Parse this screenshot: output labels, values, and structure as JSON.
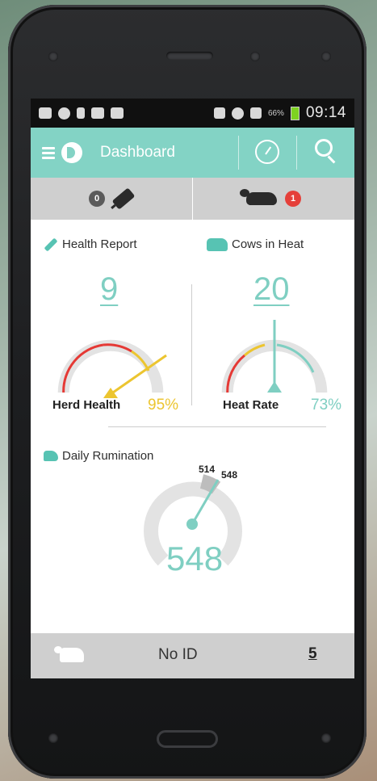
{
  "status_bar": {
    "battery_percent": "66%",
    "time": "09:14"
  },
  "app_bar": {
    "title": "Dashboard"
  },
  "tabs": [
    {
      "badge": "0",
      "icon": "plug-icon",
      "badge_color": "#5b5b5b"
    },
    {
      "badge": "1",
      "icon": "cow-lying-icon",
      "badge_color": "#e5403a"
    }
  ],
  "health_report": {
    "title": "Health Report",
    "count": "9",
    "gauge_label": "Herd Health",
    "gauge_value": "95%",
    "value_fraction": 0.95,
    "value_color": "#ecc530"
  },
  "cows_in_heat": {
    "title": "Cows in Heat",
    "count": "20",
    "gauge_label": "Heat Rate",
    "gauge_value": "73%",
    "value_fraction": 0.73,
    "value_color": "#7fcfc2"
  },
  "daily_rumination": {
    "title": "Daily Rumination",
    "value": "548",
    "reference_a": "514",
    "reference_b": "548"
  },
  "footer": {
    "id_text": "No ID",
    "count": "5"
  },
  "colors": {
    "accent": "#83d3c5",
    "teal_text": "#7fcfc2",
    "warning_red": "#e53935",
    "warning_yellow": "#ecc530",
    "gauge_gray": "#e3e3e3",
    "tab_gray": "#cfcfcf"
  }
}
